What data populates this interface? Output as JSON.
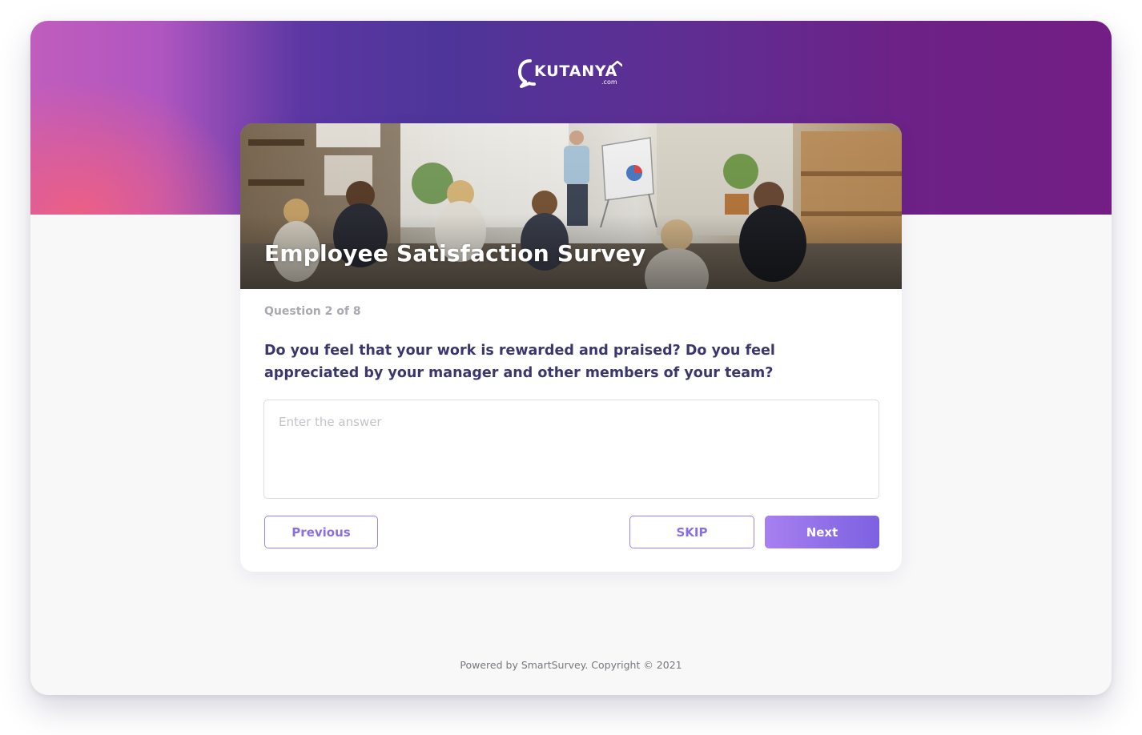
{
  "brand": {
    "logo_text": "KUTANYA",
    "logo_suffix": ".com"
  },
  "survey": {
    "title": "Employee Satisfaction Survey",
    "progress": "Question 2 of 8",
    "question": "Do you feel that your work is rewarded and praised? Do you feel appreciated by your manager and other members of your team?",
    "answer_placeholder": "Enter the answer",
    "answer_value": ""
  },
  "buttons": {
    "previous": "Previous",
    "skip": "SKIP",
    "next": "Next"
  },
  "footer": {
    "text": "Powered by SmartSurvey. Copyright © 2021"
  },
  "colors": {
    "hero_start": "#c05dbd",
    "hero_mid": "#4e3599",
    "hero_end": "#731e84",
    "accent": "#8b6fe0",
    "question_text": "#3b376e"
  },
  "icons": {
    "logo": "chat-bubble-logo-icon"
  }
}
